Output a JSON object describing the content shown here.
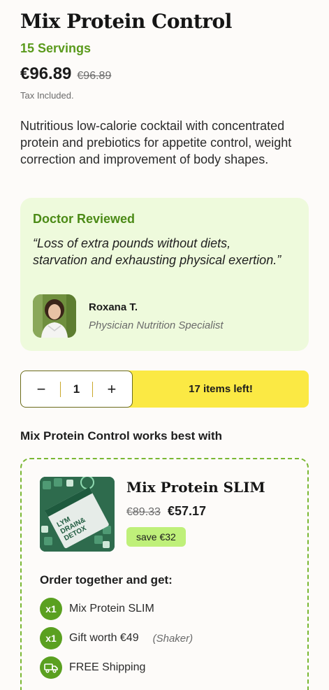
{
  "product": {
    "title": "Mix Protein Control",
    "servings": "15 Servings",
    "price": "€96.89",
    "price_old": "€96.89",
    "tax_note": "Tax Included.",
    "description": "Nutritious low-calorie cocktail with concentrated protein and prebiotics for appetite control, weight correction and improvement of body shapes."
  },
  "review": {
    "heading": "Doctor Reviewed",
    "quote": "“Loss of extra pounds without diets, starvation and exhausting physical exertion.”",
    "name": "Roxana T.",
    "role": "Physician Nutrition Specialist"
  },
  "cart": {
    "minus": "−",
    "quantity": "1",
    "plus": "+",
    "stock": "17 items left!"
  },
  "bundle": {
    "heading": "Mix Protein Control works best with",
    "product_name": "Mix Protein SLIM",
    "price_old": "€89.33",
    "price_new": "€57.17",
    "save": "save €32",
    "order_heading": "Order together and get:",
    "perks": [
      {
        "icon": "x1",
        "text": "Mix Protein SLIM",
        "note": ""
      },
      {
        "icon": "x1",
        "text": "Gift worth €49",
        "note": "(Shaker)"
      },
      {
        "icon": "truck-icon",
        "text": "FREE Shipping",
        "note": ""
      }
    ],
    "package_text": "LYM DRAIN& DETOX"
  },
  "colors": {
    "accent_green": "#5a9a1c",
    "review_bg": "#eefadc",
    "stock_yellow": "#fbe944",
    "badge_green": "#bff07a"
  }
}
